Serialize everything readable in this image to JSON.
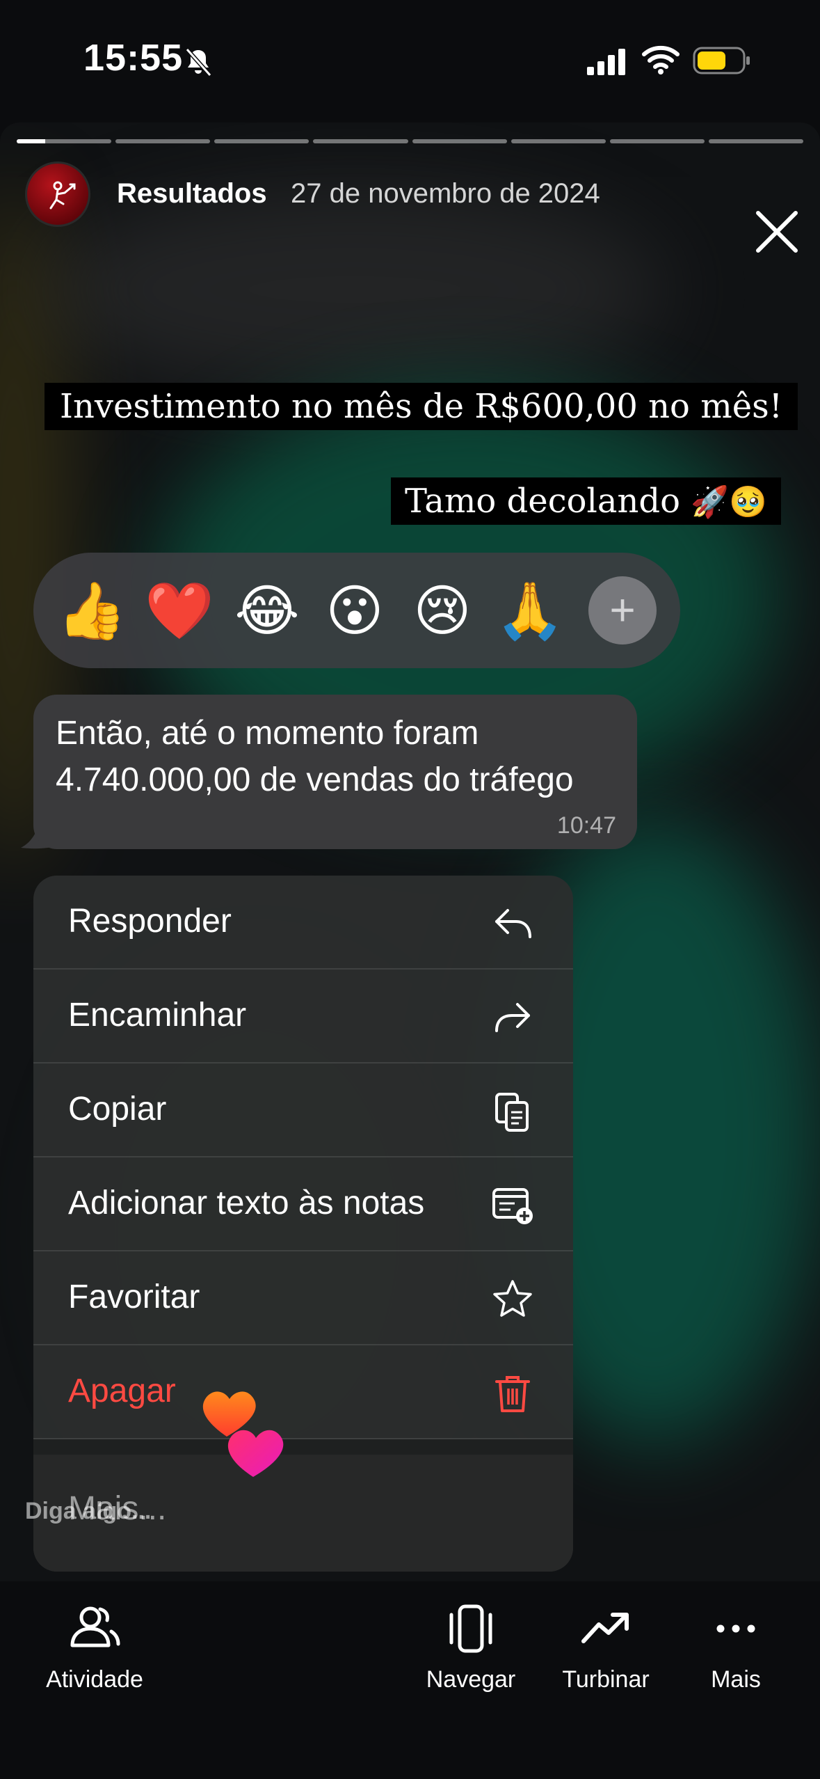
{
  "status_bar": {
    "time": "15:55"
  },
  "story": {
    "progress": {
      "segments": 8,
      "current_index": 0,
      "current_fill": 0.3
    },
    "account_name": "Resultados",
    "date": "27 de novembro de 2024",
    "caption_1": "Investimento no mês de R$600,00 no mês!",
    "caption_2_text": "Tamo decolando ",
    "caption_2_emoji": "🚀🥹",
    "reactions": [
      "👍",
      "❤️",
      "😂",
      "😮",
      "😢",
      "🙏"
    ],
    "reaction_more": "+",
    "message": {
      "text": "Então, até o momento foram 4.740.000,00 de vendas do tráfego",
      "time": "10:47"
    },
    "menu": [
      {
        "label": "Responder",
        "icon": "reply-icon"
      },
      {
        "label": "Encaminhar",
        "icon": "forward-icon"
      },
      {
        "label": "Copiar",
        "icon": "copy-icon"
      },
      {
        "label": "Adicionar texto às notas",
        "icon": "add-note-icon"
      },
      {
        "label": "Favoritar",
        "icon": "star-icon"
      },
      {
        "label": "Apagar",
        "icon": "trash-icon",
        "destructive": true
      }
    ],
    "menu_more": "Mais...",
    "reply_prompt": "Diga algo..."
  },
  "bottom_bar": {
    "activity_label": "Atividade",
    "navigate_label": "Navegar",
    "boost_label": "Turbinar",
    "more_label": "Mais"
  },
  "colors": {
    "background": "#0b0c0e",
    "bubble": "#3a3a3c",
    "menu": "#2c2e2e",
    "destructive": "#ff4a42",
    "battery": "#ffd60a",
    "avatar": "#b4131b"
  }
}
